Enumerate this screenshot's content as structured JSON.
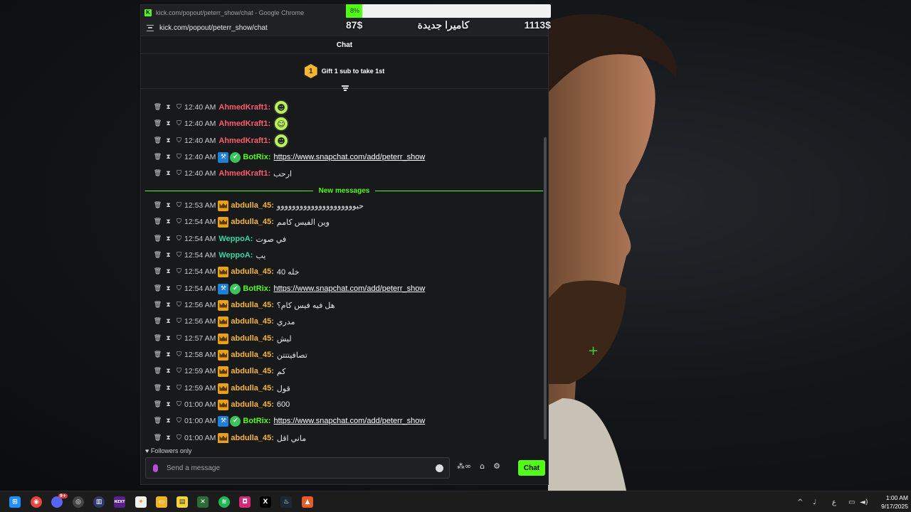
{
  "browser": {
    "window_title": "kick.com/popout/peterr_show/chat - Google Chrome",
    "url": "kick.com/popout/peterr_show/chat"
  },
  "chat": {
    "header_title": "Chat",
    "gift_rank": "1",
    "gift_text": "Gift 1 sub to take 1st",
    "new_messages_label": "New messages",
    "followers_mode": "Followers only",
    "input_placeholder": "Send a message",
    "send_label": "Chat",
    "messages": [
      {
        "time": "12:40 AM",
        "user": "AhmedKraft1",
        "color": "#ff5a6e",
        "badges": [],
        "emote": "alien-green",
        "text": ""
      },
      {
        "time": "12:40 AM",
        "user": "AhmedKraft1",
        "color": "#ff5a6e",
        "badges": [],
        "emote": "alien-yellow",
        "text": ""
      },
      {
        "time": "12:40 AM",
        "user": "AhmedKraft1",
        "color": "#ff5a6e",
        "badges": [],
        "emote": "alien-wink",
        "text": ""
      },
      {
        "time": "12:40 AM",
        "user": "BotRix",
        "color": "#53fc18",
        "badges": [
          "bot",
          "verified"
        ],
        "link": "https://www.snapchat.com/add/peterr_show"
      },
      {
        "time": "12:40 AM",
        "user": "AhmedKraft1",
        "color": "#ff5a6e",
        "badges": [],
        "text": "ارحب"
      },
      {
        "time": "12:53 AM",
        "user": "abdulla_45",
        "color": "#f5b63a",
        "badges": [
          "crown"
        ],
        "text": "حيووووووووووووووووووووو"
      },
      {
        "time": "12:54 AM",
        "user": "abdulla_45",
        "color": "#f5b63a",
        "badges": [
          "crown"
        ],
        "text": "وين الفيس كامم"
      },
      {
        "time": "12:54 AM",
        "user": "WeppoA",
        "color": "#38d6a3",
        "badges": [],
        "text": "في صوت"
      },
      {
        "time": "12:54 AM",
        "user": "WeppoA",
        "color": "#38d6a3",
        "badges": [],
        "text": "يب"
      },
      {
        "time": "12:54 AM",
        "user": "abdulla_45",
        "color": "#f5b63a",
        "badges": [
          "crown"
        ],
        "text": "خله 40"
      },
      {
        "time": "12:54 AM",
        "user": "BotRix",
        "color": "#53fc18",
        "badges": [
          "bot",
          "verified"
        ],
        "link": "https://www.snapchat.com/add/peterr_show"
      },
      {
        "time": "12:56 AM",
        "user": "abdulla_45",
        "color": "#f5b63a",
        "badges": [
          "crown"
        ],
        "text": "هل فيه فيس كام؟"
      },
      {
        "time": "12:56 AM",
        "user": "abdulla_45",
        "color": "#f5b63a",
        "badges": [
          "crown"
        ],
        "text": "مدري"
      },
      {
        "time": "12:57 AM",
        "user": "abdulla_45",
        "color": "#f5b63a",
        "badges": [
          "crown"
        ],
        "text": "ليش"
      },
      {
        "time": "12:58 AM",
        "user": "abdulla_45",
        "color": "#f5b63a",
        "badges": [
          "crown"
        ],
        "text": "تصافيتتتن"
      },
      {
        "time": "12:59 AM",
        "user": "abdulla_45",
        "color": "#f5b63a",
        "badges": [
          "crown"
        ],
        "text": "كم"
      },
      {
        "time": "12:59 AM",
        "user": "abdulla_45",
        "color": "#f5b63a",
        "badges": [
          "crown"
        ],
        "text": "قول"
      },
      {
        "time": "01:00 AM",
        "user": "abdulla_45",
        "color": "#f5b63a",
        "badges": [
          "crown"
        ],
        "text": "600"
      },
      {
        "time": "01:00 AM",
        "user": "BotRix",
        "color": "#53fc18",
        "badges": [
          "bot",
          "verified"
        ],
        "link": "https://www.snapchat.com/add/peterr_show"
      },
      {
        "time": "01:00 AM",
        "user": "abdulla_45",
        "color": "#f5b63a",
        "badges": [
          "crown"
        ],
        "text": "ماني اقل"
      }
    ]
  },
  "overlay_goal": {
    "percent_label": "8%",
    "progress": 0.08,
    "current": "87$",
    "title": "كاميرا جديدة",
    "target": "1113$"
  },
  "taskbar": {
    "clock_time": "1:00 AM",
    "clock_date": "9/17/2025",
    "discord_badge": "9+",
    "tray_lang": "ع"
  },
  "colors": {
    "kick_green": "#53fc18",
    "crown_badge": "#e8a21a"
  }
}
